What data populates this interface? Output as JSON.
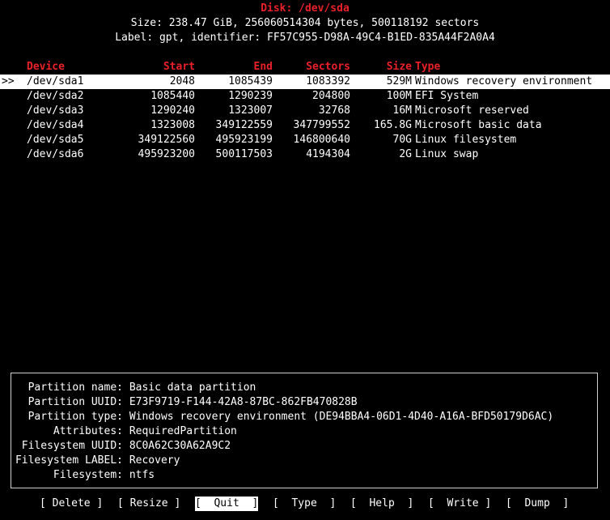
{
  "disk": {
    "title": "Disk: /dev/sda",
    "size_line": "Size: 238.47 GiB, 256060514304 bytes, 500118192 sectors",
    "label_line": "Label: gpt, identifier: FF57C955-D98A-49C4-B1ED-835A44F2A0A4"
  },
  "table": {
    "headers": [
      "Device",
      "Start",
      "End",
      "Sectors",
      "Size",
      "Type"
    ],
    "selector": ">>",
    "rows": [
      {
        "device": "/dev/sda1",
        "start": "2048",
        "end": "1085439",
        "sectors": "1083392",
        "size": "529M",
        "type": "Windows recovery environment",
        "selected": true
      },
      {
        "device": "/dev/sda2",
        "start": "1085440",
        "end": "1290239",
        "sectors": "204800",
        "size": "100M",
        "type": "EFI System",
        "selected": false
      },
      {
        "device": "/dev/sda3",
        "start": "1290240",
        "end": "1323007",
        "sectors": "32768",
        "size": "16M",
        "type": "Microsoft reserved",
        "selected": false
      },
      {
        "device": "/dev/sda4",
        "start": "1323008",
        "end": "349122559",
        "sectors": "347799552",
        "size": "165.8G",
        "type": "Microsoft basic data",
        "selected": false
      },
      {
        "device": "/dev/sda5",
        "start": "349122560",
        "end": "495923199",
        "sectors": "146800640",
        "size": "70G",
        "type": "Linux filesystem",
        "selected": false
      },
      {
        "device": "/dev/sda6",
        "start": "495923200",
        "end": "500117503",
        "sectors": "4194304",
        "size": "2G",
        "type": "Linux swap",
        "selected": false
      }
    ]
  },
  "info": [
    {
      "label": "Partition name:",
      "value": "Basic data partition"
    },
    {
      "label": "Partition UUID:",
      "value": "E73F9719-F144-42A8-87BC-862FB470828B"
    },
    {
      "label": "Partition type:",
      "value": "Windows recovery environment (DE94BBA4-06D1-4D40-A16A-BFD50179D6AC)"
    },
    {
      "label": "Attributes:",
      "value": "RequiredPartition"
    },
    {
      "label": "Filesystem UUID:",
      "value": "8C0A62C30A62A9C2"
    },
    {
      "label": "Filesystem LABEL:",
      "value": "Recovery"
    },
    {
      "label": "Filesystem:",
      "value": "ntfs"
    }
  ],
  "menu": [
    {
      "label": "[ Delete ]",
      "active": false
    },
    {
      "label": "[ Resize ]",
      "active": false
    },
    {
      "label": "[  Quit  ]",
      "active": true
    },
    {
      "label": "[  Type  ]",
      "active": false
    },
    {
      "label": "[  Help  ]",
      "active": false
    },
    {
      "label": "[  Write ]",
      "active": false
    },
    {
      "label": "[  Dump  ]",
      "active": false
    }
  ],
  "colors": {
    "header": "#e8202a",
    "background": "#000000",
    "foreground": "#ffffff"
  }
}
